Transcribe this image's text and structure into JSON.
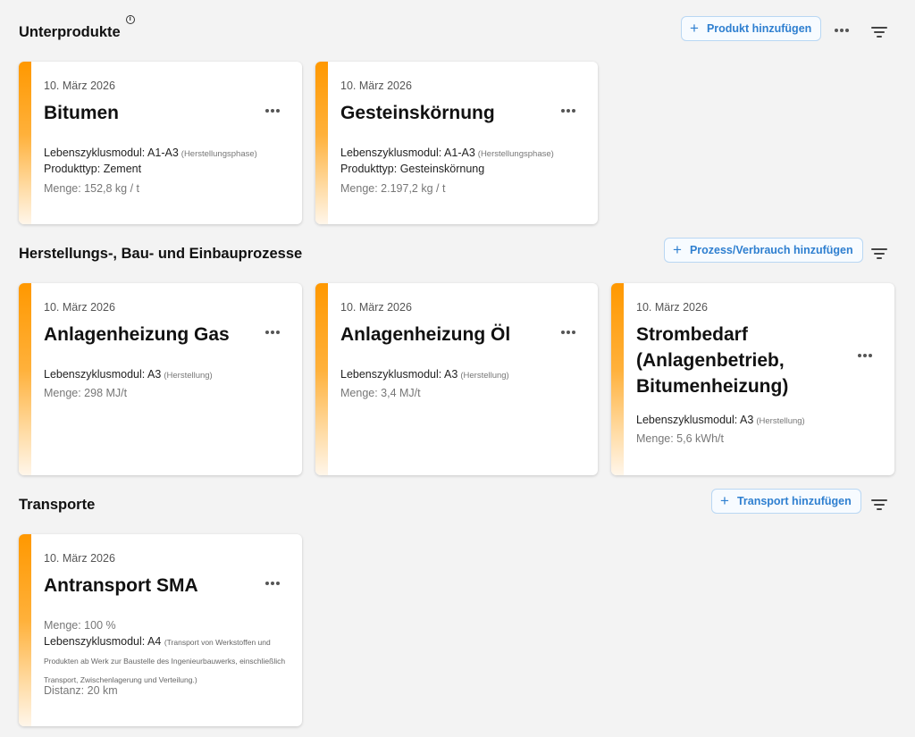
{
  "sections": {
    "products": {
      "title": "Unterprodukte",
      "add_label": "Produkt hinzufügen",
      "cards": [
        {
          "date": "10. März 2026",
          "title": "Bitumen",
          "lifecycle_label": "Lebenszyklusmodul: A1-A3",
          "lifecycle_note": "(Herstellungsphase)",
          "type": "Produkttyp: Zement",
          "amount": "Menge: 152,8 kg / t"
        },
        {
          "date": "10. März 2026",
          "title": "Gesteinskörnung",
          "lifecycle_label": "Lebenszyklusmodul: A1-A3",
          "lifecycle_note": "(Herstellungsphase)",
          "type": "Produkttyp: Gesteinskörnung",
          "amount": "Menge: 2.197,2 kg / t"
        }
      ]
    },
    "processes": {
      "title": "Herstellungs-, Bau- und Einbauprozesse",
      "add_label": "Prozess/Verbrauch hinzufügen",
      "cards": [
        {
          "date": "10. März 2026",
          "title": "Anlagenheizung Gas",
          "lifecycle_label": "Lebenszyklusmodul: A3",
          "lifecycle_note": "(Herstellung)",
          "amount": "Menge: 298 MJ/t"
        },
        {
          "date": "10. März 2026",
          "title": "Anlagenheizung Öl",
          "lifecycle_label": "Lebenszyklusmodul: A3",
          "lifecycle_note": "(Herstellung)",
          "amount": "Menge: 3,4 MJ/t"
        },
        {
          "date": "10. März 2026",
          "title": "Strombedarf (Anlagenbetrieb, Bitumenheizung)",
          "lifecycle_label": "Lebenszyklusmodul: A3",
          "lifecycle_note": "(Herstellung)",
          "amount": "Menge: 5,6 kWh/t"
        }
      ]
    },
    "transports": {
      "title": "Transporte",
      "add_label": "Transport hinzufügen",
      "cards": [
        {
          "date": "10. März 2026",
          "title": "Antransport SMA",
          "amount": "Menge: 100 %",
          "lifecycle_label": "Lebenszyklusmodul: A4",
          "lifecycle_note": "(Transport von Werkstoffen und Produkten ab Werk zur Baustelle des Ingenieurbauwerks, einschließlich Transport, Zwischenlagerung und Verteilung.)",
          "distance": "Distanz: 20 km"
        }
      ]
    }
  },
  "icons": {
    "add": "plus-icon",
    "more": "more-horizontal-icon",
    "filter": "filter-icon",
    "info": "info-icon"
  },
  "colors": {
    "accent_orange": "#ff9800",
    "button_blue": "#2e7fd0",
    "background": "#f3f3f3"
  }
}
